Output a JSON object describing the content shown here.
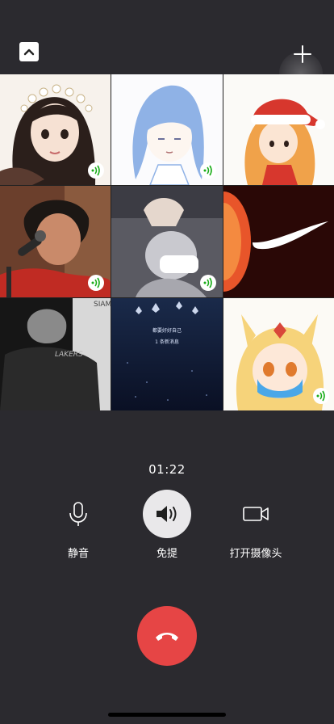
{
  "call": {
    "timer": "01:22",
    "controls": [
      {
        "id": "mute",
        "label": "静音",
        "icon": "microphone-icon"
      },
      {
        "id": "speaker",
        "label": "免提",
        "icon": "speaker-icon",
        "active": true
      },
      {
        "id": "camera",
        "label": "打开摄像头",
        "icon": "video-camera-icon"
      }
    ],
    "hangup_icon": "hang-up-phone-icon",
    "colors": {
      "hangup": "#e64545",
      "speaking": "#1aad19",
      "background": "#2b2a2f"
    }
  },
  "tiles": [
    {
      "name": "girl-with-flower-crown",
      "speaking": true
    },
    {
      "name": "blue-hair-sketch",
      "speaking": true
    },
    {
      "name": "girl-santa-hat",
      "speaking": false
    },
    {
      "name": "singer-microphone",
      "speaking": true
    },
    {
      "name": "masked-person-hand",
      "speaking": true
    },
    {
      "name": "nike-orange-burst",
      "speaking": false
    },
    {
      "name": "lakers-man-bw",
      "speaking": false
    },
    {
      "name": "lotus-night-sky",
      "speaking": false
    },
    {
      "name": "fox-girl-mask",
      "speaking": true
    }
  ],
  "tile_texts": {
    "siam_mark": "SIAM",
    "lakers_mark": "LAKERS",
    "lotus_line1": "都要好好自己",
    "lotus_line2": "1 条新消息"
  }
}
